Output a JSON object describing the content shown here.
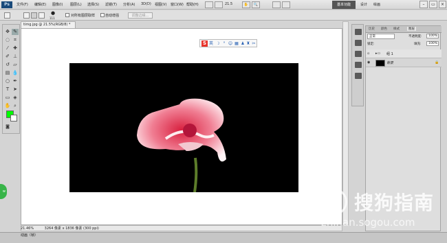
{
  "app": {
    "logo": "Ps"
  },
  "menu": [
    {
      "label": "文件(F)"
    },
    {
      "label": "编辑(E)"
    },
    {
      "label": "图像(I)"
    },
    {
      "label": "图层(L)"
    },
    {
      "label": "选择(S)"
    },
    {
      "label": "滤镜(T)"
    },
    {
      "label": "分析(A)"
    },
    {
      "label": "3D(D)"
    },
    {
      "label": "视图(V)"
    },
    {
      "label": "窗口(W)"
    },
    {
      "label": "帮助(H)"
    }
  ],
  "zoom_menu": "21.5",
  "workspaces": {
    "active": "基本功能",
    "design": "设计",
    "painting": "绘画"
  },
  "options": {
    "brush_size": "111",
    "sample_all_layers": "对所有图层取样",
    "auto_enhance": "自动增强",
    "refine_edge": "调整边缘..."
  },
  "document": {
    "tab_title": "timg.jpg @ 21.5%(RGB/8) *",
    "zoom_status": "21.46%",
    "info_status": "3264 像素 x 1836 像素 (300 ppi)",
    "bottom_tab": "动画（帧）"
  },
  "colors": {
    "foreground": "#00ff00",
    "background": "#ffffff"
  },
  "layers_panel": {
    "tabs": [
      "历史",
      "颜色",
      "样式",
      "图层"
    ],
    "active_tab": "图层",
    "blend_mode": "正常",
    "opacity_label": "不透明度:",
    "opacity": "100%",
    "lock_label": "锁定:",
    "fill_label": "填充:",
    "fill": "100%",
    "layers": [
      {
        "name": "组 1",
        "type": "group"
      },
      {
        "name": "背景",
        "type": "background",
        "locked": true
      }
    ]
  },
  "watermark": {
    "text": "搜狗指南",
    "url": "zhinan.sogou.com"
  },
  "side_badge": "w"
}
